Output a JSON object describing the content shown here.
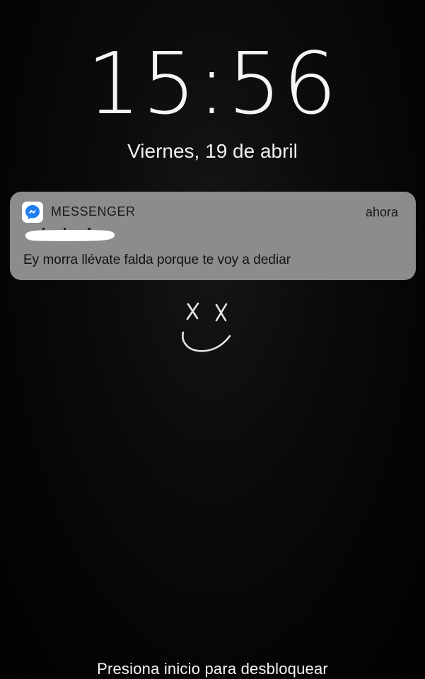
{
  "lock_screen": {
    "time": "15:56",
    "date": "Viernes, 19 de abril",
    "unlock_hint": "Presiona inicio para desbloquear"
  },
  "notification": {
    "app_name": "MESSENGER",
    "app_icon": "messenger-icon",
    "time": "ahora",
    "sender": "",
    "message": "Ey morra llévate falda porque te voy a dediar"
  },
  "wallpaper": {
    "doodle_icon": "xx-smiley-icon"
  },
  "colors": {
    "background": "#000000",
    "notification_bg": "#8c8c8c",
    "messenger_blue": "#1f7ff0",
    "text_light": "#f5f5f5",
    "text_dark": "#111111"
  }
}
